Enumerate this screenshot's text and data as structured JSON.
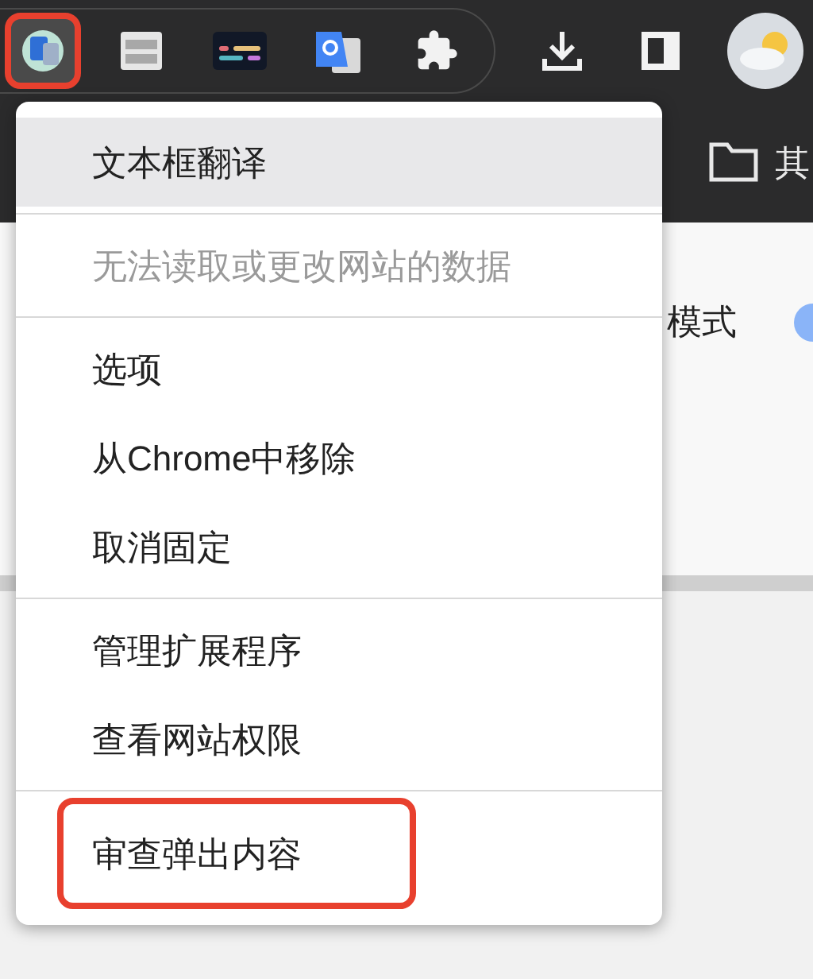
{
  "toolbar": {
    "extensions": [
      {
        "kind": "translator",
        "annotated": true
      },
      {
        "kind": "window",
        "annotated": false
      },
      {
        "kind": "code",
        "annotated": false
      },
      {
        "kind": "translate",
        "annotated": false
      },
      {
        "kind": "puzzle",
        "annotated": false
      }
    ]
  },
  "bookmarks_bar": {
    "folder": "其"
  },
  "page": {
    "label": "模式"
  },
  "menu": {
    "sections": [
      [
        {
          "label": "文本框翻译",
          "disabled": false,
          "hovered": true,
          "annotated": false
        }
      ],
      [
        {
          "label": "无法读取或更改网站的数据",
          "disabled": true,
          "hovered": false,
          "annotated": false
        }
      ],
      [
        {
          "label": "选项",
          "disabled": false,
          "hovered": false,
          "annotated": false
        },
        {
          "label": "从Chrome中移除",
          "disabled": false,
          "hovered": false,
          "annotated": false
        },
        {
          "label": "取消固定",
          "disabled": false,
          "hovered": false,
          "annotated": false
        }
      ],
      [
        {
          "label": "管理扩展程序",
          "disabled": false,
          "hovered": false,
          "annotated": false
        },
        {
          "label": "查看网站权限",
          "disabled": false,
          "hovered": false,
          "annotated": false
        }
      ],
      [
        {
          "label": "审查弹出内容",
          "disabled": false,
          "hovered": false,
          "annotated": true
        }
      ]
    ]
  }
}
